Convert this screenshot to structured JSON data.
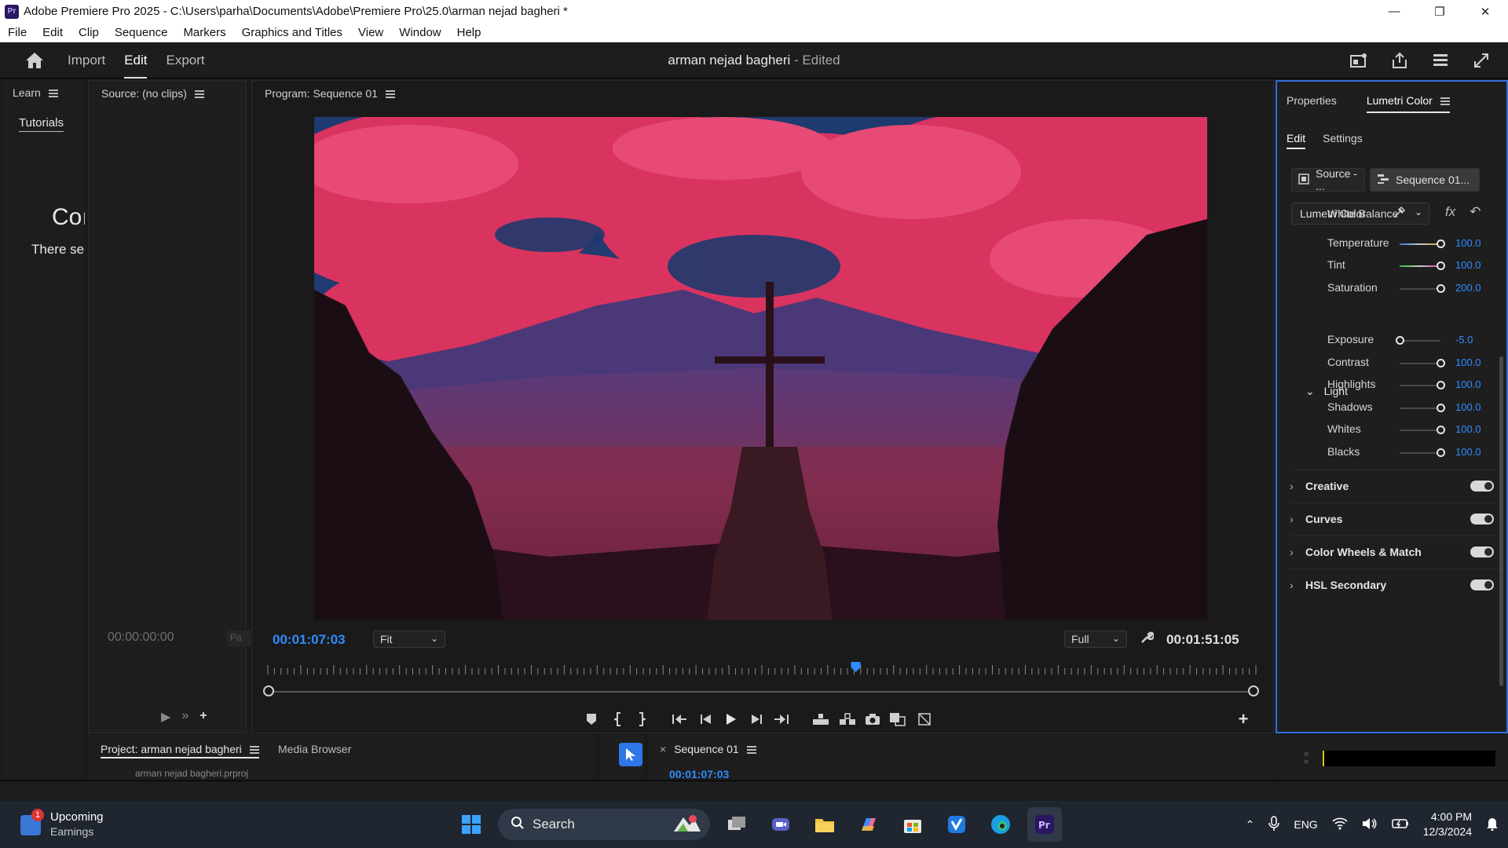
{
  "window": {
    "title": "Adobe Premiere Pro 2025 - C:\\Users\\parha\\Documents\\Adobe\\Premiere Pro\\25.0\\arman nejad bagheri *",
    "controls": [
      "minimize",
      "restore",
      "close"
    ]
  },
  "menu": [
    "File",
    "Edit",
    "Clip",
    "Sequence",
    "Markers",
    "Graphics and Titles",
    "View",
    "Window",
    "Help"
  ],
  "header": {
    "nav": [
      "Import",
      "Edit",
      "Export"
    ],
    "active_nav": "Edit",
    "project_name": "arman nejad bagheri",
    "edited_suffix": " - Edited"
  },
  "learn": {
    "title": "Learn",
    "tab": "Tutorials",
    "heading_partial": "Coı",
    "text_partial": "There se"
  },
  "source": {
    "title": "Source: (no clips)",
    "timecode": "00:00:00:00",
    "page_button": "Pa"
  },
  "program": {
    "title": "Program: Sequence 01",
    "current_timecode": "00:01:07:03",
    "zoom": "Fit",
    "resolution": "Full",
    "duration": "00:01:51:05",
    "playhead_position": 0.595
  },
  "properties": {
    "tabs": [
      "Properties",
      "Lumetri Color"
    ],
    "active_tab": "Lumetri Color",
    "sub_tabs": [
      "Edit",
      "Settings"
    ],
    "active_sub_tab": "Edit",
    "source_button": "Source - ...",
    "sequence_button": "Sequence 01...",
    "effect_dropdown": "Lumetri Color",
    "white_balance_label": "White Balance",
    "light_label": "Light",
    "rows": [
      {
        "label": "Temperature",
        "value": "100.0",
        "level": 1.0,
        "track": "temperature"
      },
      {
        "label": "Tint",
        "value": "100.0",
        "level": 1.0,
        "track": "tint"
      },
      {
        "label": "Saturation",
        "value": "200.0",
        "level": 1.0,
        "track": "plain"
      },
      {
        "label": "Exposure",
        "value": "-5.0",
        "level": 0.0,
        "track": "plain"
      },
      {
        "label": "Contrast",
        "value": "100.0",
        "level": 1.0,
        "track": "plain"
      },
      {
        "label": "Highlights",
        "value": "100.0",
        "level": 1.0,
        "track": "plain"
      },
      {
        "label": "Shadows",
        "value": "100.0",
        "level": 1.0,
        "track": "plain"
      },
      {
        "label": "Whites",
        "value": "100.0",
        "level": 1.0,
        "track": "plain"
      },
      {
        "label": "Blacks",
        "value": "100.0",
        "level": 1.0,
        "track": "plain"
      }
    ],
    "sections": [
      {
        "label": "Creative",
        "enabled": true
      },
      {
        "label": "Curves",
        "enabled": true
      },
      {
        "label": "Color Wheels & Match",
        "enabled": true
      },
      {
        "label": "HSL Secondary",
        "enabled": true
      }
    ]
  },
  "bottom": {
    "project_tab": "Project: arman nejad bagheri",
    "media_browser_tab": "Media Browser",
    "project_file_partial": "arman nejad bagheri.prproj",
    "sequence_tab": "Sequence 01",
    "sequence_timecode": "00:01:07:03"
  },
  "taskbar": {
    "widget_badge": "1",
    "widget_line1": "Upcoming",
    "widget_line2": "Earnings",
    "search_placeholder": "Search",
    "language": "ENG",
    "time": "4:00 PM",
    "date": "12/3/2024"
  },
  "colors": {
    "accent_blue": "#2f8cff",
    "panel_bg": "#1e1e1e",
    "focus_border": "#2f6edb"
  }
}
